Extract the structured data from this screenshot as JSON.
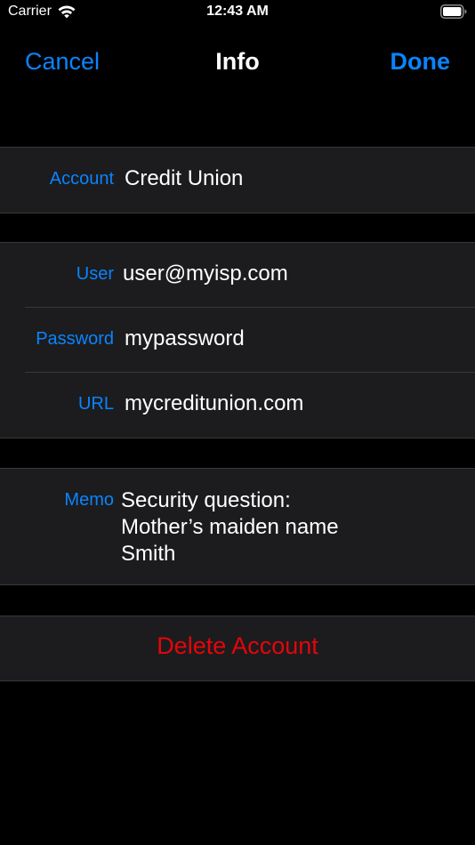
{
  "status_bar": {
    "carrier": "Carrier",
    "time": "12:43 AM"
  },
  "nav": {
    "cancel_label": "Cancel",
    "title": "Info",
    "done_label": "Done"
  },
  "account": {
    "label": "Account",
    "value": "Credit Union"
  },
  "credentials": {
    "user_label": "User",
    "user_value": "user@myisp.com",
    "password_label": "Password",
    "password_value": "mypassword",
    "url_label": "URL",
    "url_value": "mycreditunion.com"
  },
  "memo": {
    "label": "Memo",
    "lines": [
      "Security question:",
      "Mother’s maiden name",
      "Smith"
    ]
  },
  "delete": {
    "label": "Delete Account"
  },
  "colors": {
    "accent": "#0a84ff",
    "destructive": "#e5050a",
    "background": "#000000",
    "cell": "#1c1c1e"
  },
  "icons": {
    "wifi": "wifi-icon",
    "battery": "battery-icon"
  }
}
